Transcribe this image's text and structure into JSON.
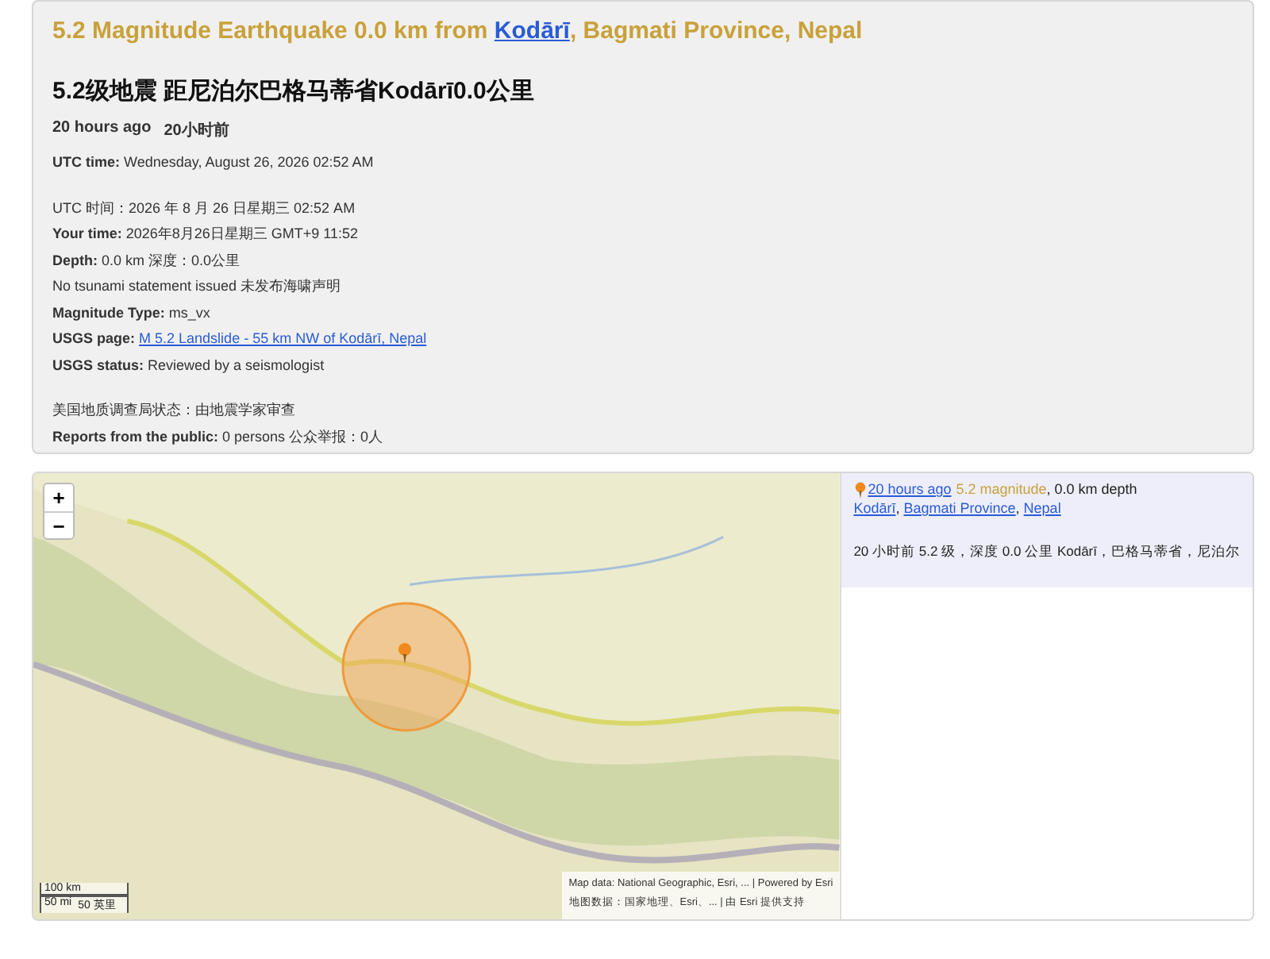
{
  "header": {
    "title_before": "5.2 Magnitude Earthquake 0.0 km from ",
    "title_link": "Kodārī",
    "title_after": ", Bagmati Province, Nepal",
    "subtitle": "5.2级地震 距尼泊尔巴格马蒂省Kodārī0.0公里",
    "ago": "20 hours ago",
    "ago_zh": "20小时前",
    "lines": [
      {
        "label": "UTC time:",
        "value": "Wednesday, August 26, 2026 02:52 AM",
        "kind": "field"
      },
      {
        "kind": "gap"
      },
      {
        "value": "UTC 时间：2026 年 8 月 26 日星期三 02:52 AM",
        "kind": "plain"
      },
      {
        "label": "Your time:",
        "value": "2026年8月26日星期三 GMT+9 11:52",
        "kind": "field"
      },
      {
        "label": "Depth:",
        "value": "0.0 km   深度：0.0公里",
        "kind": "field"
      },
      {
        "value": "No tsunami statement issued   未发布海啸声明",
        "kind": "plain"
      },
      {
        "label": "Magnitude Type:",
        "value": "ms_vx",
        "kind": "field"
      },
      {
        "label": "USGS page:",
        "link": "M 5.2 Landslide - 55 km NW of Kodārī, Nepal",
        "kind": "link"
      },
      {
        "label": "USGS status:",
        "value": "Reviewed by a seismologist",
        "kind": "field"
      },
      {
        "kind": "gap"
      },
      {
        "value": "美国地质调查局状态：由地震学家审查",
        "kind": "plain"
      },
      {
        "label": "Reports from the public:",
        "value": "0 persons   公众举报：0人",
        "kind": "field"
      }
    ]
  },
  "map": {
    "zoom_in": "+",
    "zoom_out": "−",
    "scale_km": "100 km",
    "scale_mi": "50 mi",
    "scale_mi_zh": "50 英里",
    "attribution": "Map data: National Geographic, Esri, ... | Powered by Esri",
    "attribution_zh": "地图数据：国家地理、Esri、... | 由 Esri 提供支持"
  },
  "event": {
    "ago_link": "20 hours ago",
    "magnitude": "5.2 magnitude",
    "depth": ", 0.0 km depth",
    "places": [
      {
        "name": "Kodārī",
        "sep": ", "
      },
      {
        "name": "Bagmati Province",
        "sep": ", "
      },
      {
        "name": "Nepal"
      }
    ],
    "summary_zh": "20 小时前 5.2 级，深度 0.0 公里 Kodārī，巴格马蒂省，尼泊尔"
  }
}
